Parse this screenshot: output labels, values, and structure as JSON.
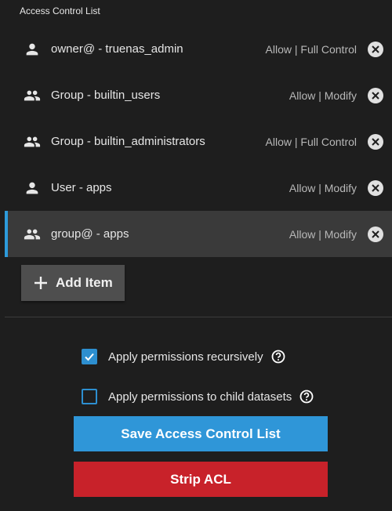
{
  "section": {
    "title": "Access Control List"
  },
  "acl_items": [
    {
      "who": "owner@ - truenas_admin",
      "permission": "Allow | Full Control",
      "icon": "person-icon",
      "selected": false
    },
    {
      "who": "Group - builtin_users",
      "permission": "Allow | Modify",
      "icon": "group-icon",
      "selected": false
    },
    {
      "who": "Group - builtin_administrators",
      "permission": "Allow | Full Control",
      "icon": "group-icon",
      "selected": false
    },
    {
      "who": "User - apps",
      "permission": "Allow | Modify",
      "icon": "person-icon",
      "selected": false
    },
    {
      "who": "group@ - apps",
      "permission": "Allow | Modify",
      "icon": "group-icon",
      "selected": true
    }
  ],
  "add_item": {
    "label": "Add Item"
  },
  "options": {
    "recursive": {
      "label": "Apply permissions recursively",
      "checked": true
    },
    "child_datasets": {
      "label": "Apply permissions to child datasets",
      "checked": false
    }
  },
  "actions": {
    "save_label": "Save Access Control List",
    "strip_label": "Strip ACL"
  },
  "colors": {
    "background": "#1e1e1e",
    "selected_row": "#3a3a3a",
    "accent_blue": "#2f96d8",
    "danger_red": "#c8222a"
  }
}
